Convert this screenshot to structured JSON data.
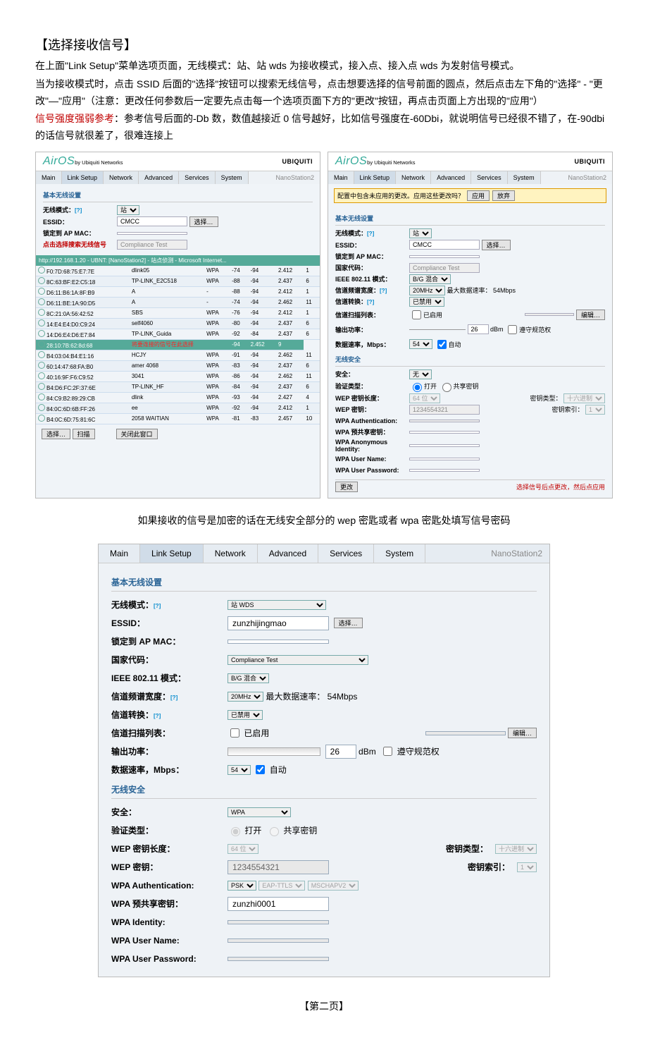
{
  "heading": "【选择接收信号】",
  "para1": "在上面\"Link Setup\"菜单选项页面，无线模式：站、站 wds 为接收模式，接入点、接入点 wds 为发射信号模式。",
  "para2": "当为接收模式时，点击 SSID 后面的\"选择\"按钮可以搜索无线信号，点击想要选择的信号前面的圆点，然后点击左下角的\"选择\" - \"更改\"—\"应用\"（注意：更改任何参数后一定要先点击每一个选项页面下方的\"更改\"按钮，再点击页面上方出现的\"应用\"）",
  "para3a": "信号强度强弱参考",
  "para3b": "：参考信号后面的-Db 数，数值越接近 0 信号越好，比如信号强度在-60Dbi，就说明信号已经很不错了，在-90dbi 的话信号就很差了，很难连接上",
  "caption": "如果接收的信号是加密的话在无线安全部分的 wep 密匙或者 wpa 密匙处填写信号密码",
  "page": "【第二页】",
  "ui": {
    "logo": "AirOS",
    "logo_sub": "by Ubiquiti Networks",
    "ubnt": "UBIQUITI",
    "tabs": [
      "Main",
      "Link Setup",
      "Network",
      "Advanced",
      "Services",
      "System"
    ],
    "nano": "NanoStation2",
    "sec_basic": "基本无线设置",
    "lbl_mode": "无线模式：",
    "lbl_essid": "ESSID：",
    "lbl_lockmac": "锁定到 AP MAC：",
    "lbl_country": "国家代码：",
    "lbl_ieee": "IEEE 802.11 模式：",
    "lbl_chwidth": "信道频谱宽度：",
    "lbl_chshift": "信道转换：",
    "lbl_chscan": "信道扫描列表：",
    "lbl_power": "输出功率：",
    "lbl_rate": "数据速率，Mbps：",
    "sec_sec": "无线安全",
    "lbl_sec": "安全：",
    "lbl_auth": "验证类型：",
    "lbl_weplen": "WEP 密钥长度：",
    "lbl_wepkey": "WEP 密钥：",
    "lbl_wpaauth": "WPA Authentication:",
    "lbl_wpapsk": "WPA 预共享密钥：",
    "lbl_wpaano": "WPA Anonymous Identity:",
    "lbl_wpaid": "WPA Identity:",
    "lbl_wpaun": "WPA User Name:",
    "lbl_wpapw": "WPA User Password:",
    "val_mode_sta": "站",
    "val_mode_stawds": "站 WDS",
    "val_essid_cmcc": "CMCC",
    "val_essid_zun": "zunzhijingmao",
    "val_compliance": "Compliance Test",
    "val_bg": "B/G 混合",
    "val_20mhz": "20MHz",
    "val_maxrate": "最大数据速率：  54Mbps",
    "val_disable": "已禁用",
    "val_enable": "已启用",
    "val_26": "26",
    "val_dbm": "dBm",
    "val_obey": "遵守规范权",
    "val_54": "54",
    "val_auto": "自动",
    "val_none": "无",
    "val_wpa": "WPA",
    "val_open": "打开",
    "val_shared": "共享密钥",
    "lbl_keytype": "密钥类型：",
    "lbl_keyidx": "密钥索引：",
    "val_hex": "十六进制",
    "val_64": "64 位",
    "val_wepkey": "1234554321",
    "val_psk": "PSK",
    "val_eap": "EAP-TTLS",
    "val_msch": "MSCHAPV2",
    "val_wpapsk": "zunzhi0001",
    "val_1": "1",
    "btn_select": "选择…",
    "btn_edit": "编辑…",
    "btn_change": "更改",
    "btn_scan": "扫描",
    "btn_close": "关闭此窗口",
    "btn_apply": "应用",
    "btn_discard": "放弃",
    "yellow_msg": "配置中包含未应用的更改。应用这些更改吗？",
    "red_note1": "点击选择搜索无线信号",
    "red_note2": "将要连接的信号在此选择",
    "red_note3": "选择信号后点更改，然后点应用",
    "survey_title": "http://192.168.1.20 - UBNT: [NanoStation2] - 站点侦测 - Microsoft Internet..."
  },
  "survey": [
    {
      "mac": "F0:7D:68:75:E7:7E",
      "name": "dlink05",
      "enc": "WPA",
      "sig": "-74",
      "noi": "-94",
      "freq": "2.412",
      "ch": "1"
    },
    {
      "mac": "8C:63:BF:E2:C5:18",
      "name": "TP-LINK_E2C518",
      "enc": "WPA",
      "sig": "-88",
      "noi": "-94",
      "freq": "2.437",
      "ch": "6"
    },
    {
      "mac": "D6:11:B6:1A:8F:B9",
      "name": "A",
      "enc": "-",
      "sig": "-88",
      "noi": "-94",
      "freq": "2.412",
      "ch": "1"
    },
    {
      "mac": "D6:11:BE:1A:90:D5",
      "name": "A",
      "enc": "-",
      "sig": "-74",
      "noi": "-94",
      "freq": "2.462",
      "ch": "11"
    },
    {
      "mac": "8C:21:0A:56:42:52",
      "name": "SBS",
      "enc": "WPA",
      "sig": "-76",
      "noi": "-94",
      "freq": "2.412",
      "ch": "1"
    },
    {
      "mac": "14:E4:E4:D0:C9:24",
      "name": "self4060",
      "enc": "WPA",
      "sig": "-80",
      "noi": "-94",
      "freq": "2.437",
      "ch": "6"
    },
    {
      "mac": "14:D6:E4:D6:E7:84",
      "name": "TP-LINK_Guida",
      "enc": "WPA",
      "sig": "-92",
      "noi": "-84",
      "freq": "2.437",
      "ch": "6"
    },
    {
      "mac": "28:10:7B:62:8d:68",
      "name": "",
      "enc": "",
      "sig": "",
      "noi": "-94",
      "freq": "2.452",
      "ch": "9"
    },
    {
      "mac": "B4:03:04:B4:E1:16",
      "name": "HCJY",
      "enc": "WPA",
      "sig": "-91",
      "noi": "-94",
      "freq": "2.462",
      "ch": "11"
    },
    {
      "mac": "60:14:47:68:FA:B0",
      "name": "amer 4068",
      "enc": "WPA",
      "sig": "-83",
      "noi": "-94",
      "freq": "2.437",
      "ch": "6"
    },
    {
      "mac": "40:16:9F:F6:C9:52",
      "name": "3041",
      "enc": "WPA",
      "sig": "-86",
      "noi": "-94",
      "freq": "2.462",
      "ch": "11"
    },
    {
      "mac": "B4:D6:FC:2F:37:6E",
      "name": "TP-LINK_HF",
      "enc": "WPA",
      "sig": "-84",
      "noi": "-94",
      "freq": "2.437",
      "ch": "6"
    },
    {
      "mac": "84:C9:B2:89:29:CB",
      "name": "dlink",
      "enc": "WPA",
      "sig": "-93",
      "noi": "-94",
      "freq": "2.427",
      "ch": "4"
    },
    {
      "mac": "84:0C:6D:6B:FF:26",
      "name": "ee",
      "enc": "WPA",
      "sig": "-92",
      "noi": "-94",
      "freq": "2.412",
      "ch": "1"
    },
    {
      "mac": "B4:0C:6D:75:81:6C",
      "name": "2058 WAITIAN",
      "enc": "WPA",
      "sig": "-81",
      "noi": "-83",
      "freq": "2.457",
      "ch": "10"
    }
  ]
}
